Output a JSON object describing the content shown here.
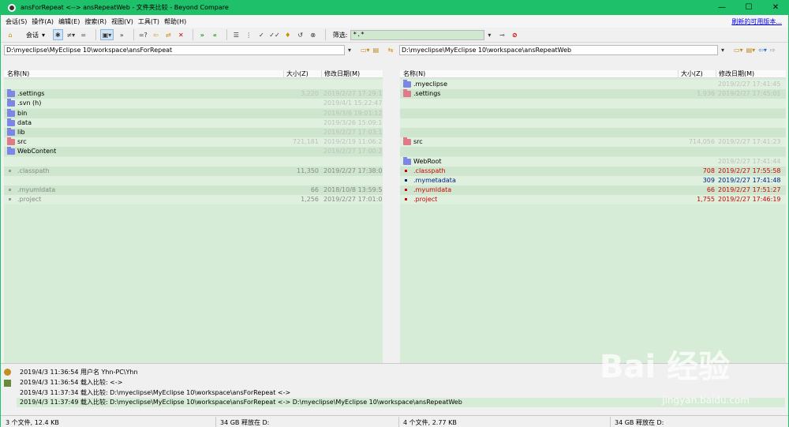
{
  "window": {
    "title": "ansForRepeat <--> ansRepeatWeb - 文件夹比较 - Beyond Compare",
    "controls": [
      "—",
      "☐",
      "✕"
    ]
  },
  "menu": {
    "items": [
      "会话(S)",
      "操作(A)",
      "编辑(E)",
      "搜索(R)",
      "视图(V)",
      "工具(T)",
      "帮助(H)"
    ],
    "update_link": "刷新的可用版本..."
  },
  "toolbar": {
    "session_label": "会话",
    "more": "»",
    "filter_label": "筛选:",
    "filter_value": "*.*"
  },
  "left": {
    "path": "D:\\myeclipse\\MyEclipse 10\\workspace\\ansForRepeat",
    "col_name": "名称(N)",
    "col_size": "大小(Z)",
    "col_date": "修改日期(M)",
    "rows": [
      {
        "name": "",
        "size": "",
        "date": "",
        "kind": "empty"
      },
      {
        "name": ".settings",
        "size": "3,220",
        "date": "2019/2/27 17:29:11",
        "kind": "folder-blue",
        "style": "faded"
      },
      {
        "name": ".svn (h)",
        "size": "",
        "date": "2019/4/1 15:22:47",
        "kind": "folder-blue",
        "style": "faded"
      },
      {
        "name": "bin",
        "size": "",
        "date": "2019/3/6 19:01:12",
        "kind": "folder-blue",
        "style": "faded"
      },
      {
        "name": "data",
        "size": "",
        "date": "2019/3/26 15:09:16",
        "kind": "folder-blue",
        "style": "faded"
      },
      {
        "name": "lib",
        "size": "",
        "date": "2019/2/27 17:03:12",
        "kind": "folder-blue",
        "style": "faded"
      },
      {
        "name": "src",
        "size": "721,181",
        "date": "2019/2/19 11:06:29",
        "kind": "folder-red",
        "style": "faded"
      },
      {
        "name": "WebContent",
        "size": "",
        "date": "2019/2/27 17:00:21",
        "kind": "folder-blue",
        "style": "faded"
      },
      {
        "name": "",
        "size": "",
        "date": "",
        "kind": "empty"
      },
      {
        "name": ".classpath",
        "size": "11,350",
        "date": "2019/2/27 17:38:02",
        "kind": "file-grey",
        "style": "grey"
      },
      {
        "name": "",
        "size": "",
        "date": "",
        "kind": "empty"
      },
      {
        "name": ".myumldata",
        "size": "66",
        "date": "2018/10/8 13:59:58",
        "kind": "file-grey",
        "style": "grey"
      },
      {
        "name": ".project",
        "size": "1,256",
        "date": "2019/2/27 17:01:06",
        "kind": "file-grey",
        "style": "grey"
      }
    ]
  },
  "right": {
    "path": "D:\\myeclipse\\MyEclipse 10\\workspace\\ansRepeatWeb",
    "col_name": "名称(N)",
    "col_size": "大小(Z)",
    "col_date": "修改日期(M)",
    "rows": [
      {
        "name": ".myeclipse",
        "size": "",
        "date": "2019/2/27 17:41:45",
        "kind": "folder-blue",
        "style": "faded"
      },
      {
        "name": ".settings",
        "size": "1,936",
        "date": "2019/2/27 17:45:01",
        "kind": "folder-red",
        "style": "faded"
      },
      {
        "name": "",
        "size": "",
        "date": "",
        "kind": "empty"
      },
      {
        "name": "",
        "size": "",
        "date": "",
        "kind": "empty"
      },
      {
        "name": "",
        "size": "",
        "date": "",
        "kind": "empty"
      },
      {
        "name": "",
        "size": "",
        "date": "",
        "kind": "empty"
      },
      {
        "name": "src",
        "size": "714,056",
        "date": "2019/2/27 17:41:23",
        "kind": "folder-red",
        "style": "faded"
      },
      {
        "name": "",
        "size": "",
        "date": "",
        "kind": "empty"
      },
      {
        "name": "WebRoot",
        "size": "",
        "date": "2019/2/27 17:41:44",
        "kind": "folder-blue",
        "style": "faded"
      },
      {
        "name": ".classpath",
        "size": "708",
        "date": "2019/2/27 17:55:58",
        "kind": "file-red",
        "style": "red"
      },
      {
        "name": ".mymetadata",
        "size": "309",
        "date": "2019/2/27 17:41:48",
        "kind": "file-blue",
        "style": "blue"
      },
      {
        "name": ".myumldata",
        "size": "66",
        "date": "2019/2/27 17:51:27",
        "kind": "file-red",
        "style": "red"
      },
      {
        "name": ".project",
        "size": "1,755",
        "date": "2019/2/27 17:46:19",
        "kind": "file-red",
        "style": "red"
      }
    ]
  },
  "log": {
    "lines": [
      "2019/4/3 11:36:54   用户名 Yhn-PC\\Yhn",
      "2019/4/3 11:36:54   载入比较: <->",
      "2019/4/3 11:37:34   载入比较: D:\\myeclipse\\MyEclipse 10\\workspace\\ansForRepeat <->",
      "2019/4/3 11:37:49   载入比较: D:\\myeclipse\\MyEclipse 10\\workspace\\ansForRepeat <-> D:\\myeclipse\\MyEclipse 10\\workspace\\ansRepeatWeb"
    ]
  },
  "status": {
    "left_files": "3 个文件, 12.4 KB",
    "left_free": "34 GB 释放在 D:",
    "right_files": "4 个文件, 2.77 KB",
    "right_free": "34 GB 释放在 D:"
  },
  "watermark": {
    "text": "Bai 经验",
    "url": "jingyan.baidu.com"
  }
}
